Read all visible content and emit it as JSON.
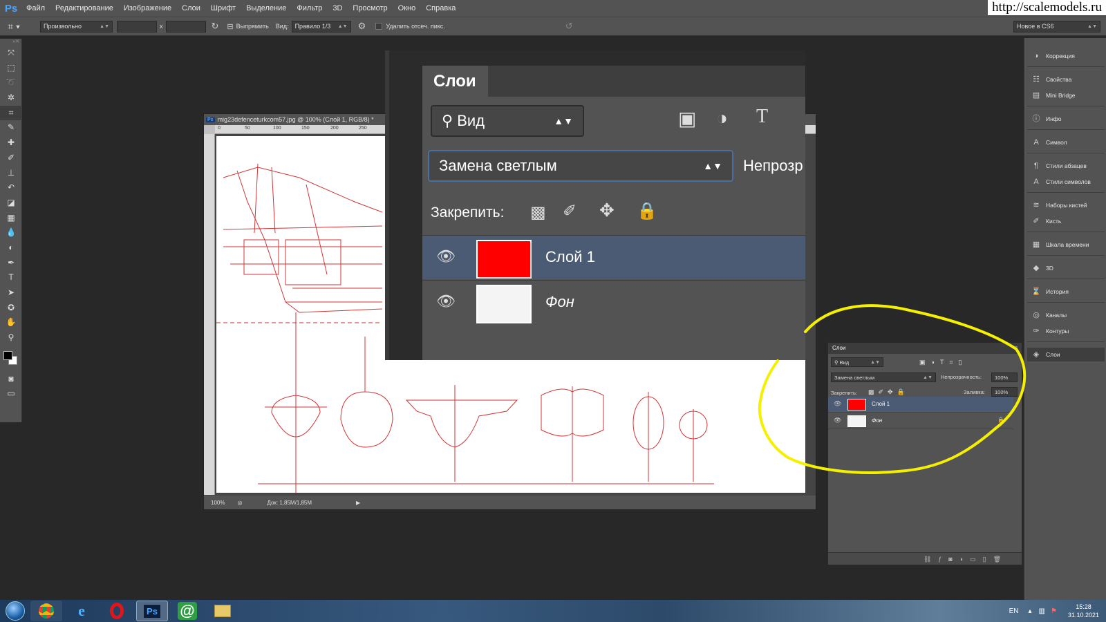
{
  "app": {
    "logo": "Ps",
    "menu": [
      "Файл",
      "Редактирование",
      "Изображение",
      "Слои",
      "Шрифт",
      "Выделение",
      "Фильтр",
      "3D",
      "Просмотр",
      "Окно",
      "Справка"
    ],
    "watermark": "http://scalemodels.ru"
  },
  "options": {
    "ratio": "Произвольно",
    "x_sep": "x",
    "straighten": "Выпрямить",
    "view_label": "Вид:",
    "view_value": "Правило 1/3",
    "delete_cropped": "Удалить отсеч. пикс.",
    "workspace": "Новое в CS6"
  },
  "tools": [
    "move-tool",
    "marquee-tool",
    "lasso-tool",
    "magic-wand-tool",
    "crop-tool",
    "eyedropper-tool",
    "healing-brush-tool",
    "brush-tool",
    "clone-stamp-tool",
    "history-brush-tool",
    "eraser-tool",
    "gradient-tool",
    "blur-tool",
    "dodge-tool",
    "pen-tool",
    "type-tool",
    "path-selection-tool",
    "shape-tool",
    "hand-tool",
    "zoom-tool"
  ],
  "document": {
    "title": "mig23defenceturkcom57.jpg @ 100% (Слой 1, RGB/8) *",
    "ruler_ticks": [
      "0",
      "50",
      "100",
      "150",
      "200",
      "250"
    ],
    "zoom": "100%",
    "doc_size": "Док: 1,85M/1,85M"
  },
  "zoom_panel": {
    "tab": "Слои",
    "filter": "Вид",
    "blend_mode": "Замена светлым",
    "opacity_label": "Непрозр",
    "lock_label": "Закрепить:",
    "layers": [
      {
        "name": "Слой 1",
        "color": "#ff0000"
      },
      {
        "name": "Фон",
        "color": "#ffffff"
      }
    ]
  },
  "dock": {
    "items": [
      "Коррекция",
      "Свойства",
      "Mini Bridge",
      "Инфо",
      "Символ",
      "Стили абзацев",
      "Стили символов",
      "Наборы кистей",
      "Кисть",
      "Шкала времени",
      "3D",
      "История",
      "Каналы",
      "Контуры",
      "Слои"
    ]
  },
  "small_panel": {
    "tab": "Слои",
    "filter": "Вид",
    "blend_mode": "Замена светлым",
    "opacity_label": "Непрозрачность:",
    "opacity_value": "100%",
    "lock_label": "Закрепить:",
    "fill_label": "Заливка:",
    "fill_value": "100%",
    "layers": [
      {
        "name": "Слой 1",
        "color": "#ff0000"
      },
      {
        "name": "Фон",
        "color": "#ffffff"
      }
    ]
  },
  "taskbar": {
    "apps": [
      "start-button",
      "chrome",
      "internet-explorer",
      "opera",
      "photoshop",
      "mail-agent",
      "file-explorer"
    ],
    "ps_label": "Ps",
    "mail_label": "@",
    "language": "EN",
    "time": "15:28",
    "date": "31.10.2021"
  },
  "colors": {
    "accent_annotation": "#f5f000",
    "layer_selected": "#4a5b73",
    "ps_blue": "#4aa3ff"
  }
}
